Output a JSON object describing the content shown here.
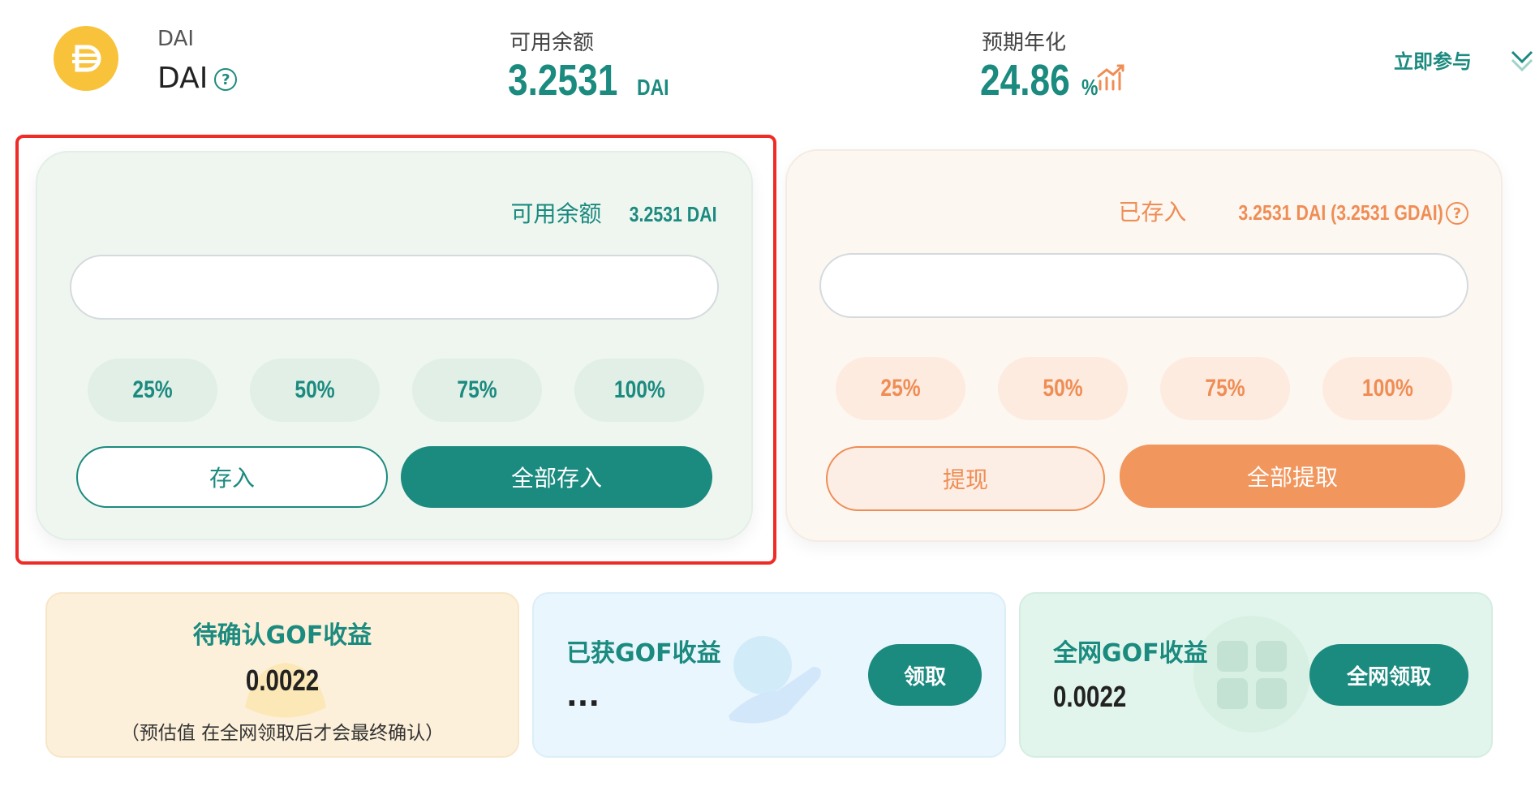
{
  "header": {
    "coin_sub": "DAI",
    "coin_name": "DAI",
    "help_glyph": "?",
    "balance_label": "可用余额",
    "balance_value": "3.2531",
    "balance_unit": "DAI",
    "apy_label": "预期年化",
    "apy_value": "24.86",
    "apy_unit": "%",
    "join_label": "立即参与"
  },
  "deposit": {
    "balance_label": "可用余额",
    "balance_value": "3.2531 DAI",
    "input_value": "",
    "percents": [
      "25%",
      "50%",
      "75%",
      "100%"
    ],
    "deposit_label": "存入",
    "deposit_all_label": "全部存入"
  },
  "withdraw": {
    "deposited_label": "已存入",
    "deposited_value": "3.2531 DAI (3.2531 GDAI)",
    "input_value": "",
    "percents": [
      "25%",
      "50%",
      "75%",
      "100%"
    ],
    "withdraw_label": "提现",
    "withdraw_all_label": "全部提取"
  },
  "rewards": {
    "pending_title": "待确认GOF收益",
    "pending_value": "0.0022",
    "pending_note": "（预估值 在全网领取后才会最终确认）",
    "earned_title": "已获GOF收益",
    "earned_value": "...",
    "claim_label": "领取",
    "network_title": "全网GOF收益",
    "network_value": "0.0022",
    "network_claim_label": "全网领取"
  },
  "colors": {
    "primary": "#1b8a7f",
    "accent_orange": "#ef8d55",
    "highlight_red": "#ee2b26",
    "coin_yellow": "#f8c33b"
  },
  "icons": {
    "coin": "dai-coin-icon",
    "help": "question-circle-icon",
    "trend": "trend-up-icon",
    "expand": "double-chevron-down-icon"
  }
}
